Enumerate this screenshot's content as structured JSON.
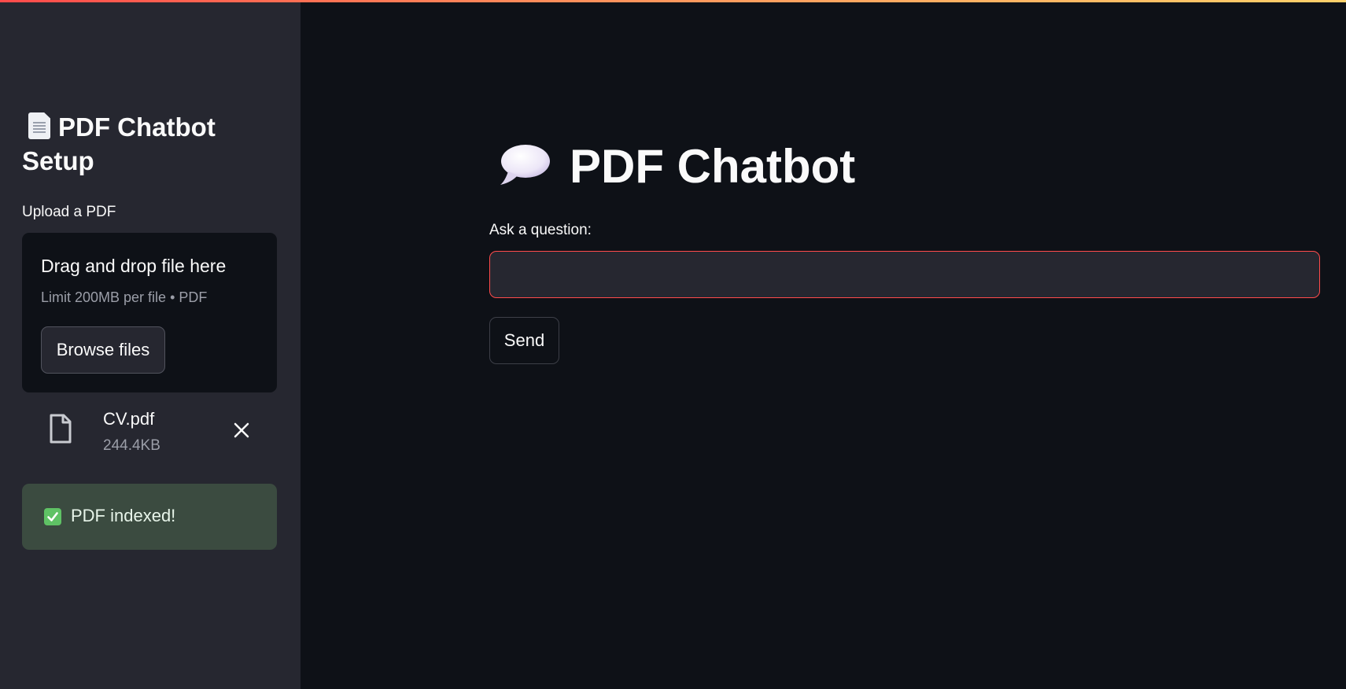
{
  "sidebar": {
    "title": "PDF Chatbot Setup",
    "title_icon": "page-icon",
    "upload_label": "Upload a PDF",
    "dropzone": {
      "title": "Drag and drop file here",
      "limit": "Limit 200MB per file • PDF",
      "browse_label": "Browse files"
    },
    "uploaded_file": {
      "icon": "file-icon",
      "name": "CV.pdf",
      "size": "244.4KB",
      "remove_icon": "close-icon"
    },
    "success": {
      "icon": "check-mark-icon",
      "text": "PDF indexed!",
      "color": "#3b4b40"
    }
  },
  "main": {
    "title": "PDF Chatbot",
    "title_icon": "speech-balloon-icon",
    "question_label": "Ask a question:",
    "question_value": "",
    "send_label": "Send"
  },
  "colors": {
    "background": "#0e1117",
    "sidebar": "#262730",
    "accent": "#ff4b4b",
    "text": "#fafafa"
  }
}
